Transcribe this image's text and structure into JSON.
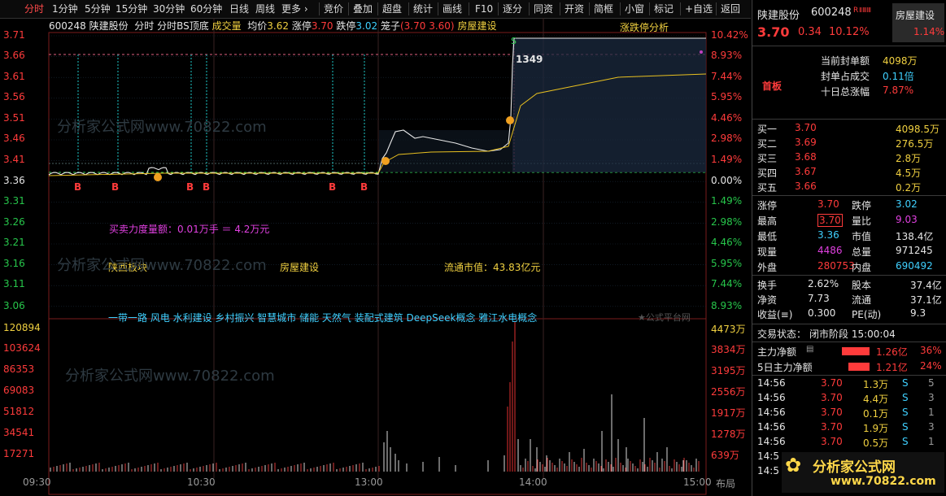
{
  "toolbar": {
    "tabs": [
      "分时",
      "1分钟",
      "5分钟",
      "15分钟",
      "30分钟",
      "60分钟",
      "日线",
      "周线",
      "更多 ›"
    ],
    "buttons": [
      "竞价",
      "叠加",
      "超盘",
      "统计",
      "画线",
      "F10",
      "逐分",
      "同资",
      "开资",
      "简框",
      "小窗",
      "标记",
      "+自选",
      "返回"
    ]
  },
  "infobar": {
    "code": "600248",
    "name": "陕建股份",
    "label_ft": "分时",
    "indicator": "分时BS顶底",
    "vol_label": "成交量",
    "avg_label": "均价",
    "avg": "3.62",
    "zt_label": "涨停",
    "zt": "3.70",
    "dt_label": "跌停",
    "dt": "3.02",
    "bask_label": "笼子",
    "bask": "(3.70",
    "bask2": "3.60)",
    "sector": "房屋建设",
    "zt_analysis": "涨跌停分析"
  },
  "price_axis": [
    "3.71",
    "3.66",
    "3.61",
    "3.56",
    "3.51",
    "3.46",
    "3.41",
    "3.36",
    "3.31",
    "3.26",
    "3.21",
    "3.16",
    "3.11",
    "3.06"
  ],
  "pct_axis": [
    "10.42%",
    "8.93%",
    "7.44%",
    "5.95%",
    "4.46%",
    "2.98%",
    "1.49%",
    "0.00%",
    "1.49%",
    "2.98%",
    "4.46%",
    "5.95%",
    "7.44%",
    "8.93%"
  ],
  "vol_axis_left": [
    "120894",
    "103624",
    "86353",
    "69083",
    "51812",
    "34541",
    "17271"
  ],
  "vol_axis_right": [
    "4473万",
    "3834万",
    "3195万",
    "2556万",
    "1917万",
    "1278万",
    "639万"
  ],
  "time_axis": [
    "09:30",
    "10:30",
    "13:00",
    "14:00",
    "15:00"
  ],
  "layout_label": "布局",
  "b_marks": [
    "B",
    "B",
    "B",
    "B",
    "B",
    "B"
  ],
  "price_1349": "1349",
  "annotations": {
    "buysell": "买卖力度量额：0.01万手 ＝ 4.2万元",
    "region": "陕西板块",
    "industry": "房屋建设",
    "float_cap": "流通市值：43.83亿元",
    "concepts": "一带一路 风电 水利建设 乡村振兴 智慧城市 储能 天然气 装配式建筑 DeepSeek概念 雅江水电概念",
    "source": "★公式平台网"
  },
  "watermarks": [
    "分析家公式网www.70822.com",
    "分析家公式网www.70822.com",
    "分析家公式网www.70822.com"
  ],
  "panel": {
    "name": "陕建股份",
    "code": "600248",
    "r": "R",
    "flag": "ⅡⅢⅢ",
    "sector": "房屋建设",
    "sector_pct": "1.14%",
    "price": "3.70",
    "chg": "0.34",
    "pct": "10.12%",
    "seal_label": "当前封单额",
    "seal": "4098万",
    "seal_ratio_label": "封单占成交",
    "seal_ratio": "0.11倍",
    "ten_day_label": "十日总涨幅",
    "ten_day": "7.87%",
    "first_board": "首板",
    "bids": [
      {
        "l": "买一",
        "p": "3.70",
        "v": "4098.5万"
      },
      {
        "l": "买二",
        "p": "3.69",
        "v": "276.5万"
      },
      {
        "l": "买三",
        "p": "3.68",
        "v": "2.8万"
      },
      {
        "l": "买四",
        "p": "3.67",
        "v": "4.5万"
      },
      {
        "l": "买五",
        "p": "3.66",
        "v": "0.2万"
      }
    ],
    "stats": [
      {
        "l1": "涨停",
        "v1": "3.70",
        "l2": "跌停",
        "v2": "3.02"
      },
      {
        "l1": "最高",
        "v1": "3.70",
        "l2": "量比",
        "v2": "9.03"
      },
      {
        "l1": "最低",
        "v1": "3.36",
        "l2": "市值",
        "v2": "138.4亿"
      },
      {
        "l1": "现量",
        "v1": "4486",
        "l2": "总量",
        "v2": "971245"
      },
      {
        "l1": "外盘",
        "v1": "280753",
        "l2": "内盘",
        "v2": "690492"
      }
    ],
    "stats2": [
      {
        "l1": "换手",
        "v1": "2.62%",
        "l2": "股本",
        "v2": "37.4亿"
      },
      {
        "l1": "净资",
        "v1": "7.73",
        "l2": "流通",
        "v2": "37.1亿"
      },
      {
        "l1": "收益(≡)",
        "v1": "0.300",
        "l2": "PE(动)",
        "v2": "9.3"
      }
    ],
    "status_label": "交易状态：",
    "status": "闭市阶段 15:00:04",
    "main_net_label": "主力净额",
    "main_net": "1.26亿",
    "main_net_pct": "36%",
    "five_net_label": "5日主力净额",
    "five_net": "1.21亿",
    "five_net_pct": "24%",
    "ticks": [
      {
        "t": "14:56",
        "p": "3.70",
        "v": "1.3万",
        "d": "S",
        "n": "5"
      },
      {
        "t": "14:56",
        "p": "3.70",
        "v": "4.4万",
        "d": "S",
        "n": "3"
      },
      {
        "t": "14:56",
        "p": "3.70",
        "v": "0.1万",
        "d": "S",
        "n": "1"
      },
      {
        "t": "14:56",
        "p": "3.70",
        "v": "1.9万",
        "d": "S",
        "n": "3"
      },
      {
        "t": "14:56",
        "p": "3.70",
        "v": "0.5万",
        "d": "S",
        "n": "1"
      },
      {
        "t": "14:5",
        "p": "",
        "v": "",
        "d": "",
        "n": ""
      },
      {
        "t": "14:5",
        "p": "",
        "v": "",
        "d": "",
        "n": ""
      }
    ],
    "logo_text": "分析家公式网",
    "logo_url": "www.70822.com"
  },
  "chart_data": {
    "type": "line",
    "series": [
      {
        "name": "price",
        "x": [
          "09:30",
          "09:40",
          "09:50",
          "10:00",
          "10:10",
          "10:20",
          "10:30",
          "10:40",
          "10:50",
          "11:00",
          "11:10",
          "11:20",
          "11:30",
          "13:00",
          "13:05",
          "13:10",
          "13:20",
          "13:30",
          "13:40",
          "13:50",
          "13:55",
          "13:57",
          "14:00",
          "14:30",
          "15:00"
        ],
        "values": [
          3.36,
          3.37,
          3.37,
          3.37,
          3.38,
          3.37,
          3.37,
          3.37,
          3.37,
          3.38,
          3.37,
          3.37,
          3.37,
          3.37,
          3.4,
          3.47,
          3.46,
          3.44,
          3.43,
          3.43,
          3.5,
          3.7,
          3.7,
          3.7,
          3.7
        ]
      },
      {
        "name": "avg",
        "x": [
          "09:30",
          "10:30",
          "11:30",
          "13:00",
          "13:10",
          "13:30",
          "13:50",
          "13:57",
          "14:00",
          "14:30",
          "15:00"
        ],
        "values": [
          3.36,
          3.37,
          3.37,
          3.37,
          3.41,
          3.42,
          3.42,
          3.55,
          3.59,
          3.61,
          3.62
        ]
      }
    ],
    "ylim": [
      3.02,
      3.7
    ]
  }
}
